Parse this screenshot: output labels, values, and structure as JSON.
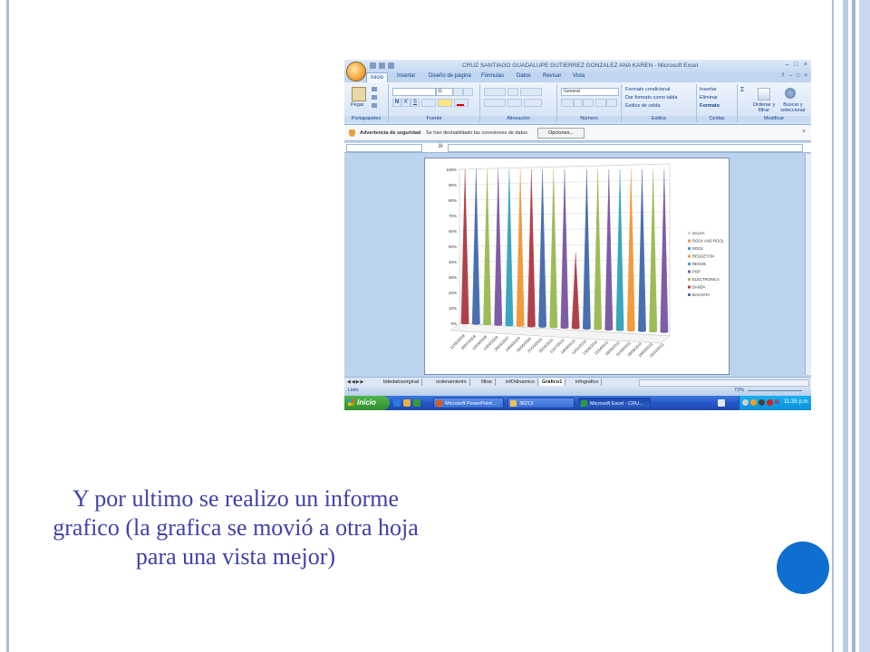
{
  "slide": {
    "caption": "Y por ultimo se realizo un informe grafico (la grafica se movió a otra hoja para una vista mejor)",
    "accent_color": "#0f6fd0",
    "text_color": "#4040aa"
  },
  "excel": {
    "title": "CRUZ SANTIAGO GUADALUPE  GUTIERREZ GONZALEZ ANA KAREN  -  Microsoft Excel",
    "tabs": [
      "Inicio",
      "Insertar",
      "Diseño de página",
      "Fórmulas",
      "Datos",
      "Revisar",
      "Vista"
    ],
    "active_tab": "Inicio",
    "ribbon": {
      "pegar": "Pegar",
      "font_size": "11",
      "number_format": "General",
      "groups": [
        "Portapapeles",
        "Fuente",
        "Alineación",
        "Número",
        "Estilos",
        "Celdas",
        "Modificar"
      ],
      "estilos": [
        "Formato condicional",
        "Dar formato como tabla",
        "Estilos de celda"
      ],
      "celdas": [
        "Insertar",
        "Eliminar",
        "Formato"
      ],
      "ordenar": "Ordenar y filtrar",
      "buscar": "Buscar y seleccionar"
    },
    "security": {
      "label": "Advertencia de seguridad",
      "message": "Se han deshabilitado las conexiones de datos",
      "button": "Opciones..."
    },
    "formula_bar": {
      "fx": "fx"
    },
    "sheet_tabs": [
      "bdedatosorginal",
      "ordenamiento",
      "filtrar",
      "infOdinamico",
      "Gráfico1",
      "infografico"
    ],
    "active_sheet": "Gráfico1",
    "status_text": "Listo",
    "zoom": "73%"
  },
  "taskbar": {
    "start": "Inicio",
    "windows": [
      "Microsoft PowerPoint ...",
      "36213",
      "Microsoft Excel - CRU..."
    ],
    "clock": "11:35 p.m.",
    "tray_letter": "N"
  },
  "chart_data": {
    "type": "bar",
    "title": "",
    "ylabel": "",
    "xlabel": "",
    "ylim": [
      0,
      1
    ],
    "yticks": [
      "0%",
      "10%",
      "20%",
      "30%",
      "40%",
      "50%",
      "60%",
      "70%",
      "80%",
      "90%",
      "100%"
    ],
    "categories": [
      "12/05/2008",
      "08/07/2008",
      "12/09/2008",
      "13/04/2009",
      "29/05/2007",
      "14/06/2009",
      "16/06/2009",
      "21/03/2010",
      "15/04/2010",
      "11/07/2010",
      "14/09/2010",
      "12/01/2010",
      "13/06/2010",
      "11/04/2011",
      "18/05/2011",
      "01/06/2011",
      "18/08/2011",
      "19/09/2011",
      "15/10/2011"
    ],
    "values": [
      1,
      1,
      1,
      1,
      1,
      1,
      1,
      1,
      1,
      1,
      0.46,
      1,
      1,
      1,
      1,
      1,
      1,
      1,
      1
    ],
    "bar_colors": [
      "#b0414a",
      "#4a6fb0",
      "#9cbc58",
      "#7e5ca6",
      "#3aa6c0",
      "#f39a3c",
      "#b0414a",
      "#4a6fb0",
      "#9cbc58",
      "#7e5ca6",
      "#b0414a",
      "#4a6fb0",
      "#9cbc58",
      "#7e5ca6",
      "#3aa6c0",
      "#f39a3c",
      "#4a6fb0",
      "#9cbc58",
      "#7e5ca6"
    ],
    "legend": [
      "SALSA",
      "ROCK AND ROOL",
      "ROCK",
      "REGGETON",
      "REGGE",
      "POP",
      "ELECTRONICA",
      "BANDA",
      "BACHATA"
    ],
    "legend_colors": [
      "#d6d6d6",
      "#f39a3c",
      "#3aa6c0",
      "#f39a3c",
      "#3aa6c0",
      "#7e5ca6",
      "#9cbc58",
      "#b0414a",
      "#4a6fb0"
    ],
    "legend_position": "right"
  }
}
